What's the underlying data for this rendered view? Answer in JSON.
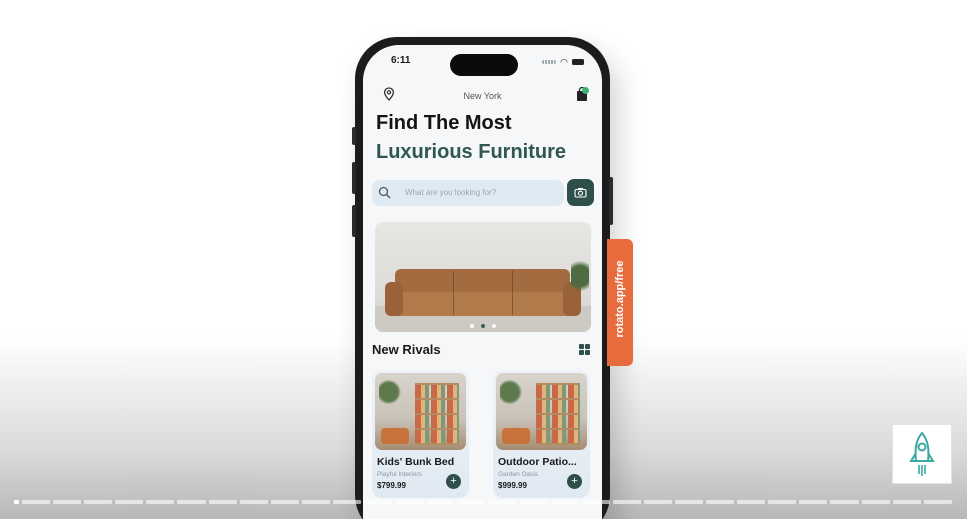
{
  "status_bar": {
    "time": "6:11"
  },
  "header": {
    "location": "New York",
    "location_icon": "location-pin-icon",
    "cart_icon": "shopping-bag-icon"
  },
  "hero": {
    "line1": "Find The Most",
    "line2": "Luxurious Furniture"
  },
  "search": {
    "placeholder": "What are you looking for?",
    "icon": "search-icon",
    "camera_icon": "camera-icon"
  },
  "banner": {
    "image": "leather-sofa",
    "slides": 3,
    "active_slide": 2
  },
  "section": {
    "title": "New Rivals",
    "view_icon": "grid-view-icon"
  },
  "products": [
    {
      "name": "Kids' Bunk Bed",
      "brand": "Playful Interiors",
      "price": "$799.99"
    },
    {
      "name": "Outdoor Patio...",
      "brand": "Garden Oasis",
      "price": "$999.99"
    }
  ],
  "promo_tag": {
    "text": "rotato.app/free"
  },
  "colors": {
    "accent": "#2f4f4b",
    "tag": "#e86b3d",
    "search_bg": "#dfe9f2"
  },
  "video": {
    "logo_icon": "rocket-icon"
  }
}
